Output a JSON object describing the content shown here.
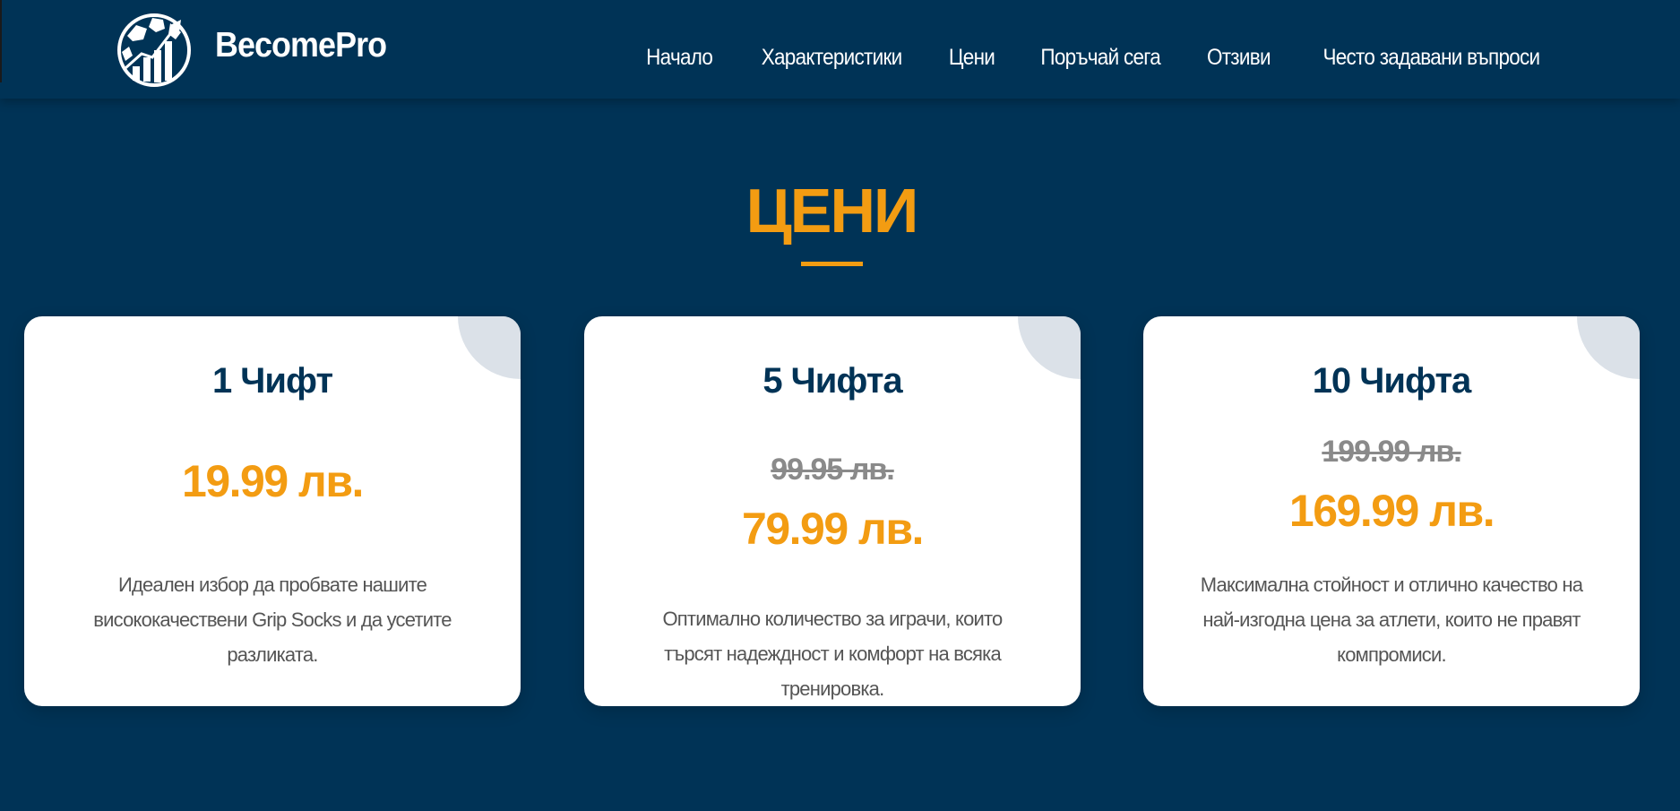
{
  "header": {
    "brand": "BecomePro",
    "nav": [
      {
        "label": "Начало"
      },
      {
        "label": "Характеристики"
      },
      {
        "label": "Цени"
      },
      {
        "label": "Поръчай сега"
      },
      {
        "label": "Отзиви"
      },
      {
        "label": "Често задавани въпроси"
      }
    ]
  },
  "pricing": {
    "title": "ЦЕНИ",
    "cards": [
      {
        "title": "1 Чифт",
        "old_price": "",
        "price": "19.99 лв.",
        "description": "Идеален избор да пробвате нашите висококачествени Grip Socks и да усетите разликата."
      },
      {
        "title": "5 Чифта",
        "old_price": "99.95 лв.",
        "price": "79.99 лв.",
        "description": "Оптимално количество за играчи, които търсят надеждност и комфорт на всяка тренировка."
      },
      {
        "title": "10 Чифта",
        "old_price": "199.99 лв.",
        "price": "169.99 лв.",
        "description": "Максимална стойност и отлично качество на най-изгодна цена за атлети, които не правят компромиси."
      }
    ]
  },
  "colors": {
    "background": "#003356",
    "accent": "#f39c12",
    "card": "#ffffff",
    "heading": "#003356",
    "muted": "#8a8a8a"
  },
  "icons": {
    "logo": "football-growth-chart-icon"
  }
}
